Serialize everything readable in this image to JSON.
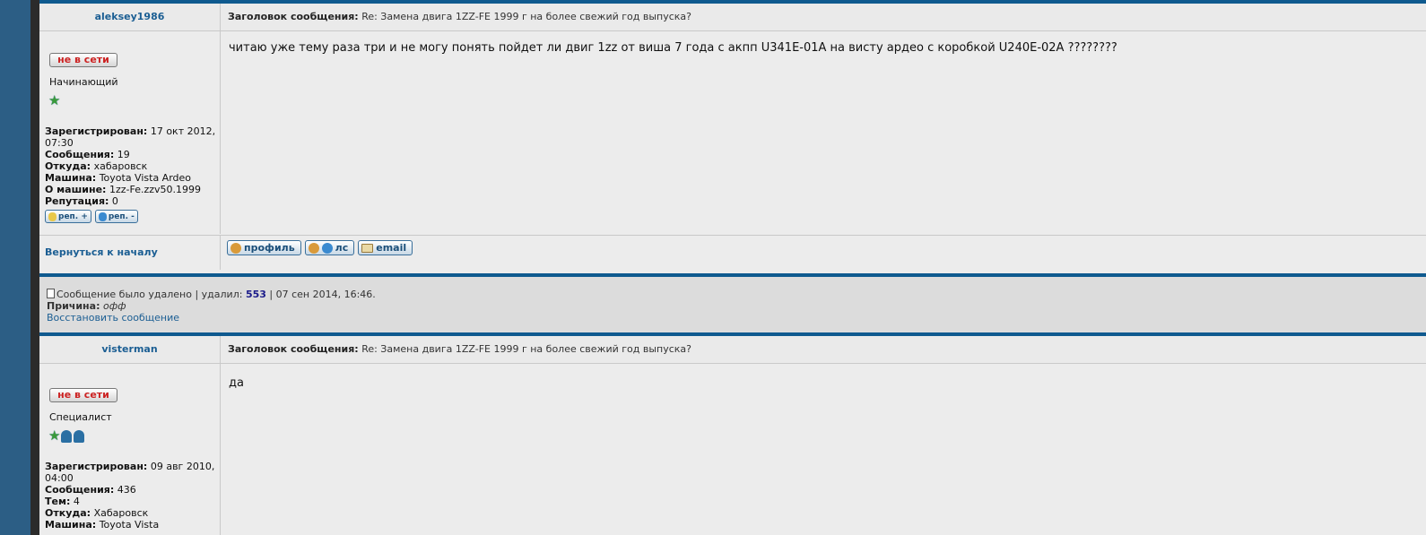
{
  "posts": [
    {
      "author": "aleksey1986",
      "subject_label": "Заголовок сообщения:",
      "subject": "Re: Замена двига 1ZZ-FE 1999 г на более свежий год выпуска?",
      "status": "не в сети",
      "rank": "Начинающий",
      "registered_label": "Зарегистрирован:",
      "registered_line1": "17 окт 2012,",
      "registered_line2": "07:30",
      "posts_label": "Сообщения:",
      "posts_count": "19",
      "from_label": "Откуда:",
      "from": "хабаровск",
      "car_label": "Машина:",
      "car": "Toyota Vista Ardeo",
      "about_label": "О машине:",
      "about": "1zz-Fe.zzv50.1999",
      "rep_label": "Репутация:",
      "rep": "0",
      "rep_plus": "реп. +",
      "rep_minus": "реп. -",
      "body": "читаю уже тему раза три и не могу понять пойдет ли двиг 1zz от виша 7 года с акпп U341E-01A на висту ардео с коробкой U240E-02A ????????",
      "back_to_top": "Вернуться к началу",
      "btn_profile": "профиль",
      "btn_pm": "лс",
      "btn_email": "email"
    },
    {
      "author": "visterman",
      "subject_label": "Заголовок сообщения:",
      "subject": "Re: Замена двига 1ZZ-FE 1999 г на более свежий год выпуска?",
      "status": "не в сети",
      "rank": "Специалист",
      "registered_label": "Зарегистрирован:",
      "registered_line1": "09 авг 2010,",
      "registered_line2": "04:00",
      "posts_label": "Сообщения:",
      "posts_count": "436",
      "topics_label": "Тем:",
      "topics": "4",
      "from_label": "Откуда:",
      "from": "Хабаровск",
      "car_label": "Машина:",
      "car": "Toyota Vista",
      "body": "да"
    }
  ],
  "deleted": {
    "text": "Сообщение было удалено | удалил:",
    "deleter": "553",
    "date": "| 07 сен 2014, 16:46.",
    "reason_label": "Причина:",
    "reason": "офф",
    "restore": "Восстановить сообщение"
  },
  "colors": {
    "accent": "#0f5a8f",
    "link": "#1b5e93",
    "offline": "#cc2222"
  }
}
